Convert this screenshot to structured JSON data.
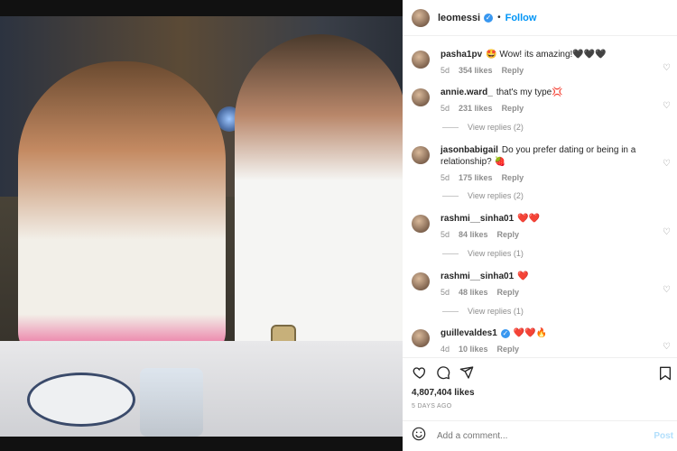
{
  "post": {
    "author": "leomessi",
    "follow_label": "Follow",
    "likes": "4,807,404 likes",
    "time_ago": "5 DAYS AGO",
    "add_comment_placeholder": "Add a comment...",
    "post_label": "Post"
  },
  "comments": [
    {
      "user": "pasha1pv",
      "text": "🤩 Wow! its amazing!🖤🖤🖤",
      "age": "5d",
      "likes": "354 likes",
      "reply": "Reply",
      "replies": ""
    },
    {
      "user": "annie.ward_",
      "text": "that's my type💢",
      "age": "5d",
      "likes": "231 likes",
      "reply": "Reply",
      "replies": "View replies (2)"
    },
    {
      "user": "jasonbabigail",
      "text": "Do you prefer dating or being in a relationship? 🍓",
      "age": "5d",
      "likes": "175 likes",
      "reply": "Reply",
      "replies": "View replies (2)"
    },
    {
      "user": "rashmi__sinha01",
      "text": "❤️❤️",
      "age": "5d",
      "likes": "84 likes",
      "reply": "Reply",
      "replies": "View replies (1)"
    },
    {
      "user": "rashmi__sinha01",
      "text": "❤️",
      "age": "5d",
      "likes": "48 likes",
      "reply": "Reply",
      "replies": "View replies (1)"
    },
    {
      "user": "guillevaldes1",
      "text": "❤️❤️🔥",
      "age": "4d",
      "likes": "10 likes",
      "reply": "Reply",
      "replies": ""
    }
  ],
  "colors": {
    "accent": "#0095f6",
    "verified": "#3897f0"
  }
}
